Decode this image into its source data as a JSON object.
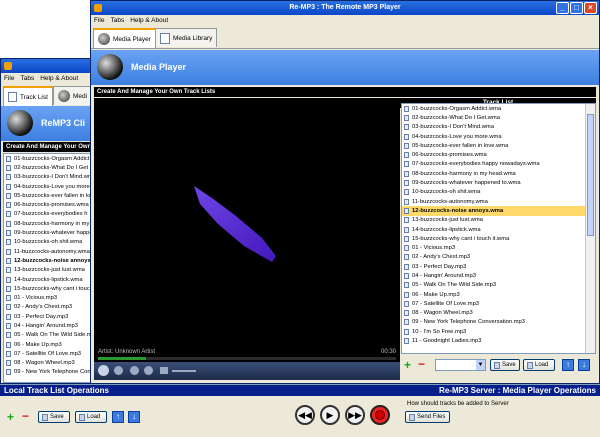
{
  "back_window": {
    "menu": [
      "File",
      "Tabs",
      "Help & About"
    ],
    "tabs": [
      {
        "label": "Track List"
      },
      {
        "label": "Medi"
      }
    ],
    "header_title": "ReMP3 Cli",
    "section_bar": "Create And Manage Your Own",
    "tracks": [
      "01-buzzcocks-Orgasm Addict",
      "02-buzzcocks-What Do I Get",
      "03-buzzcocks-I Don't Mind.wr",
      "04-buzzcocks-Love you more",
      "05-buzzcocks-ever fallen in lo",
      "06-buzzcocks-promises.wma",
      "07-buzzcocks-everybodies h",
      "08-buzzcocks-harmony in my",
      "09-buzzcocks-whatever happe",
      "10-buzzcocks-oh shit.wma",
      "11-buzzcocks-autonomy.wma",
      "12-buzzcocks-noise annoys",
      "13-buzzcocks-just lust.wma",
      "14-buzzcocks-lipstick.wma",
      "15-buzzcocks-why cant i touc",
      "01 - Vicious.mp3",
      "02 - Andy's Chest.mp3",
      "03 - Perfect Day.mp3",
      "04 - Hangin' Around.mp3",
      "05 - Walk On The Wild Side.mp",
      "06 - Make Up.mp3",
      "07 - Satellite Of Love.mp3",
      "08 - Wagon Wheel.mp3",
      "09 - New York Telephone Con"
    ],
    "bold_index": 11
  },
  "front_window": {
    "title": "Re-MP3 : The Remote MP3 Player",
    "menu": [
      "File",
      "Tabs",
      "Help & About"
    ],
    "tabs": [
      {
        "label": "Media Player"
      },
      {
        "label": "Media Library"
      }
    ],
    "header_title": "Media Player",
    "section_bar": "Create And Manage Your Own Track Lists",
    "video": {
      "artist_label": "Artist: Unknown Artist",
      "time": "00:30"
    },
    "track_list_title": "Track List",
    "tracks": [
      "01-buzzcocks-Orgasm Addict.wma",
      "02-buzzcocks-What Do I Get.wma",
      "03-buzzcocks-I Don't Mind.wma",
      "04-buzzcocks-Love you more.wma",
      "05-buzzcocks-ever fallen in love.wma",
      "06-buzzcocks-promises.wma",
      "07-buzzcocks-everybodies happy nowadays.wma",
      "08-buzzcocks-harmony in my head.wma",
      "09-buzzcocks-whatever happened to.wma",
      "10-buzzcocks-oh shit.wma",
      "11-buzzcocks-autonomy.wma",
      "12-buzzcocks-noise annoys.wma",
      "13-buzzcocks-just lust.wma",
      "14-buzzcocks-lipstick.wma",
      "15-buzzcocks-why cant i touch it.wma",
      "01 - Vicious.mp3",
      "02 - Andy's Chest.mp3",
      "03 - Perfect Day.mp3",
      "04 - Hangin' Around.mp3",
      "05 - Walk On The Wild Side.mp3",
      "06 - Make Up.mp3",
      "07 - Satellite Of Love.mp3",
      "08 - Wagon Wheel.mp3",
      "09 - New York Telephone Conversation.mp3",
      "10 - I'm So Free.mp3",
      "11 - Goodnight Ladies.mp3"
    ],
    "selected_index": 11,
    "save_label": "Save",
    "load_label": "Load"
  },
  "bottom_panel": {
    "left_title": "Local Track List Operations",
    "right_title": "Re-MP3 Server : Media Player Operations",
    "save_label": "Save",
    "load_label": "Load",
    "server_prompt": "How should tracks be added to Server",
    "send_files_label": "Send Files"
  },
  "colors": {
    "title_blue": "#0a46c8",
    "selection": "#ffd96a",
    "header_band": "#5a95ee"
  }
}
